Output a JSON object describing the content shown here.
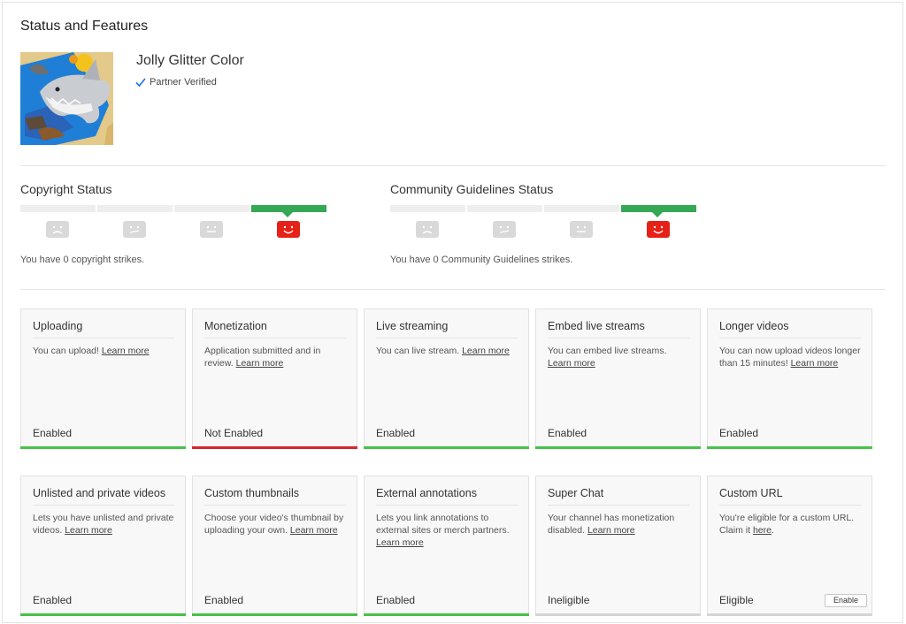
{
  "page": {
    "title": "Status and Features"
  },
  "channel": {
    "name": "Jolly Glitter Color",
    "verified_label": "Partner Verified",
    "colors": {
      "verified_check": "#1a73e8"
    }
  },
  "copyright": {
    "title": "Copyright Status",
    "strike_text": "You have 0 copyright strikes.",
    "active_level": 4
  },
  "community": {
    "title": "Community Guidelines Status",
    "strike_text": "You have 0 Community Guidelines strikes.",
    "active_level": 4
  },
  "colors": {
    "enabled": "#47c248",
    "not_enabled": "#d8262b",
    "neutral": "#d5d5d5",
    "meter_active": "#34a853",
    "face_active": "#e62117"
  },
  "features": [
    {
      "title": "Uploading",
      "desc": "You can upload!",
      "link": "Learn more",
      "state": "Enabled"
    },
    {
      "title": "Monetization",
      "desc": "Application submitted and in review.",
      "link": "Learn more",
      "state": "Not Enabled"
    },
    {
      "title": "Live streaming",
      "desc": "You can live stream.",
      "link": "Learn more",
      "state": "Enabled"
    },
    {
      "title": "Embed live streams",
      "desc": "You can embed live streams.",
      "link": "Learn more",
      "state": "Enabled"
    },
    {
      "title": "Longer videos",
      "desc": "You can now upload videos longer than 15 minutes!",
      "link": "Learn more",
      "state": "Enabled"
    },
    {
      "title": "Unlisted and private videos",
      "desc": "Lets you have unlisted and private videos.",
      "link": "Learn more",
      "state": "Enabled"
    },
    {
      "title": "Custom thumbnails",
      "desc": "Choose your video's thumbnail by uploading your own.",
      "link": "Learn more",
      "state": "Enabled"
    },
    {
      "title": "External annotations",
      "desc": "Lets you link annotations to external sites or merch partners.",
      "link": "Learn more",
      "state": "Enabled"
    },
    {
      "title": "Super Chat",
      "desc": "Your channel has monetization disabled.",
      "link": "Learn more",
      "state": "Ineligible"
    },
    {
      "title": "Custom URL",
      "desc": "You're eligible for a custom URL. Claim it",
      "link": "here",
      "desc_suffix": ".",
      "state": "Eligible",
      "button": "Enable"
    }
  ]
}
